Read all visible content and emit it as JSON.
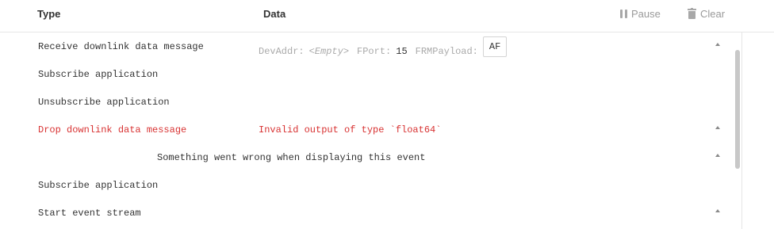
{
  "header": {
    "type_label": "Type",
    "data_label": "Data",
    "pause_label": "Pause",
    "clear_label": "Clear"
  },
  "events": [
    {
      "type": "Receive downlink data message",
      "fields": {
        "devaddr_key": "DevAddr:",
        "devaddr_value": "<Empty>",
        "fport_key": "FPort:",
        "fport_value": "15",
        "frmpayload_key": "FRMPayload:",
        "frmpayload_value": "AF"
      }
    },
    {
      "type": "Subscribe application"
    },
    {
      "type": "Unsubscribe application"
    },
    {
      "type": "Drop downlink data message",
      "error_data": "Invalid output of type `float64`"
    },
    {
      "message": "Something went wrong when displaying this event"
    },
    {
      "type": "Subscribe application"
    },
    {
      "type": "Start event stream"
    }
  ],
  "colors": {
    "error": "#d83232",
    "muted": "#aaaaaa",
    "text": "#333333"
  }
}
